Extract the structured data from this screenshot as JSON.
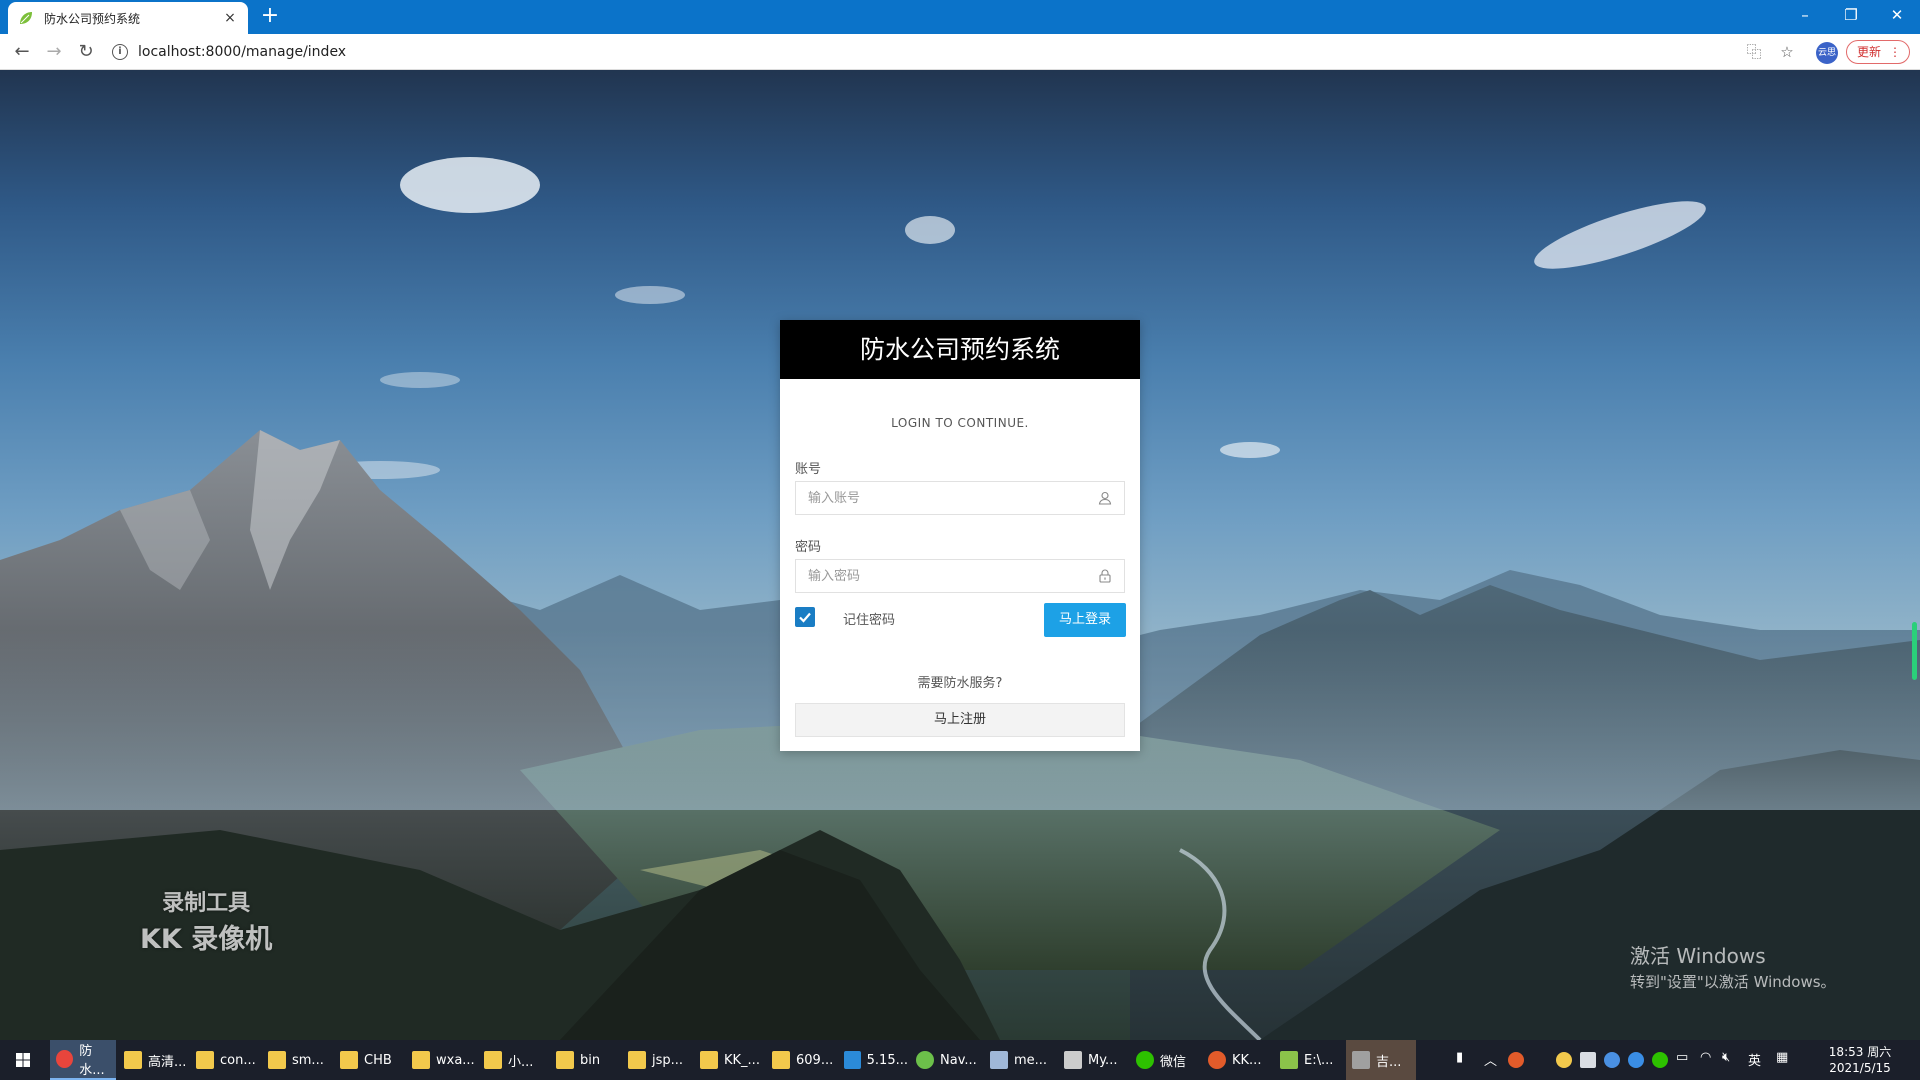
{
  "browser": {
    "tab_title": "防水公司预约系统",
    "tab_close": "×",
    "new_tab": "+",
    "url": "localhost:8000/manage/index",
    "profile_label": "云思",
    "update_label": "更新",
    "update_menu": "⋮",
    "window_controls": {
      "minimize": "–",
      "restore": "❐",
      "close": "✕"
    }
  },
  "login": {
    "title": "防水公司预约系统",
    "subtitle": "LOGIN TO CONTINUE.",
    "account_label": "账号",
    "account_placeholder": "输入账号",
    "password_label": "密码",
    "password_placeholder": "输入密码",
    "remember_label": "记住密码",
    "remember_checked": true,
    "login_button": "马上登录",
    "service_prompt": "需要防水服务?",
    "register_button": "马上注册"
  },
  "overlay": {
    "watermark_line1": "录制工具",
    "watermark_line2": "KK 录像机",
    "activate_title": "激活 Windows",
    "activate_sub": "转到\"设置\"以激活 Windows。"
  },
  "taskbar": {
    "items": [
      {
        "label": "防水...",
        "icon": "chrome-icon",
        "color": "#e8453c"
      },
      {
        "label": "高清...",
        "icon": "folder-icon",
        "color": "#f2c94c"
      },
      {
        "label": "con...",
        "icon": "folder-icon",
        "color": "#f2c94c"
      },
      {
        "label": "sm...",
        "icon": "folder-icon",
        "color": "#f2c94c"
      },
      {
        "label": "CHB",
        "icon": "folder-icon",
        "color": "#f2c94c"
      },
      {
        "label": "wxa...",
        "icon": "folder-icon",
        "color": "#f2c94c"
      },
      {
        "label": "小...",
        "icon": "folder-icon",
        "color": "#f2c94c"
      },
      {
        "label": "bin",
        "icon": "folder-icon",
        "color": "#f2c94c"
      },
      {
        "label": "jsp...",
        "icon": "folder-icon",
        "color": "#f2c94c"
      },
      {
        "label": "KK_...",
        "icon": "folder-icon",
        "color": "#f2c94c"
      },
      {
        "label": "609...",
        "icon": "folder-icon",
        "color": "#f2c94c"
      },
      {
        "label": "5.15...",
        "icon": "vscode-icon",
        "color": "#2b8ad8"
      },
      {
        "label": "Nav...",
        "icon": "navicat-icon",
        "color": "#6cc04a"
      },
      {
        "label": "me...",
        "icon": "calc-icon",
        "color": "#9fb7d8"
      },
      {
        "label": "My...",
        "icon": "feather-icon",
        "color": "#cccccc"
      },
      {
        "label": "微信",
        "icon": "wechat-icon",
        "color": "#2dc100"
      },
      {
        "label": "KK...",
        "icon": "kk-icon",
        "color": "#e25b2a"
      },
      {
        "label": "E:\\...",
        "icon": "notepad-icon",
        "color": "#8bc34a"
      },
      {
        "label": "吉...",
        "icon": "app-icon",
        "color": "#a0a0a0"
      }
    ],
    "ime": "英",
    "time": "18:53 周六",
    "date": "2021/5/15"
  },
  "colors": {
    "tabbar": "#0b73c9",
    "card_header": "#000000",
    "login_button": "#1da1e6",
    "checkbox": "#1a7dc4"
  }
}
